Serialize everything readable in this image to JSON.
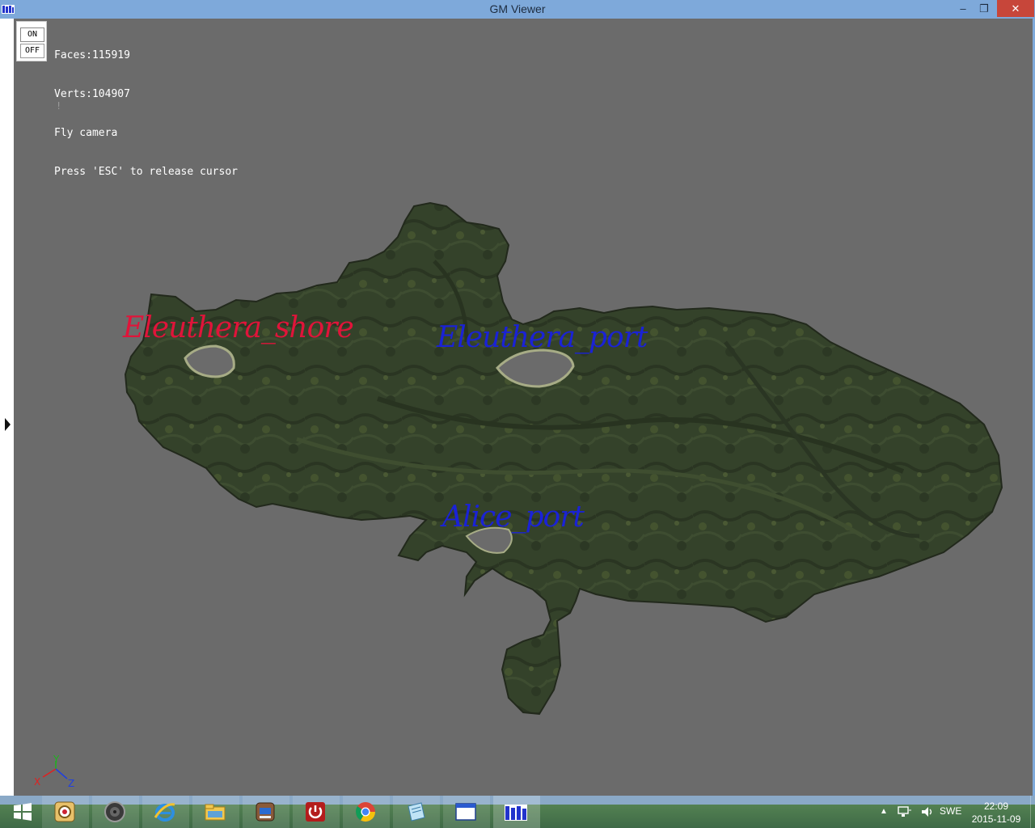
{
  "window": {
    "title": "GM Viewer",
    "buttons": {
      "minimize": "–",
      "maximize": "❐",
      "close": "✕"
    }
  },
  "overlay": {
    "toggle": {
      "on": "ON",
      "off": "OFF"
    },
    "stats": [
      "Faces:115919",
      "Verts:104907",
      "Fly camera",
      "Press 'ESC' to release cursor"
    ],
    "marker": "!"
  },
  "labels": [
    {
      "name": "Eleuthera_shore",
      "color": "#e0143a"
    },
    {
      "name": "Eleuthera_port",
      "color": "#1a22d6"
    },
    {
      "name": "Alice_port",
      "color": "#1a22d6"
    }
  ],
  "axes": {
    "x": "X",
    "y": "Y",
    "z": "Z",
    "x_color": "#e02020",
    "y_color": "#20b020",
    "z_color": "#2040e0"
  },
  "taskbar": {
    "apps": [
      {
        "icon": "windows-start-icon"
      },
      {
        "icon": "settings-app-icon"
      },
      {
        "icon": "speaker-app-icon"
      },
      {
        "icon": "internet-explorer-icon"
      },
      {
        "icon": "file-explorer-icon"
      },
      {
        "icon": "document-app-icon"
      },
      {
        "icon": "power-app-icon"
      },
      {
        "icon": "chrome-icon"
      },
      {
        "icon": "notepad-icon"
      },
      {
        "icon": "window-app-icon"
      },
      {
        "icon": "gm-viewer-icon"
      }
    ],
    "tray": {
      "language": "SWE",
      "time": "22:09",
      "date": "2015-11-09"
    }
  },
  "colors": {
    "viewport_bg": "#6b6b6b",
    "titlebar": "#7ea9da"
  }
}
